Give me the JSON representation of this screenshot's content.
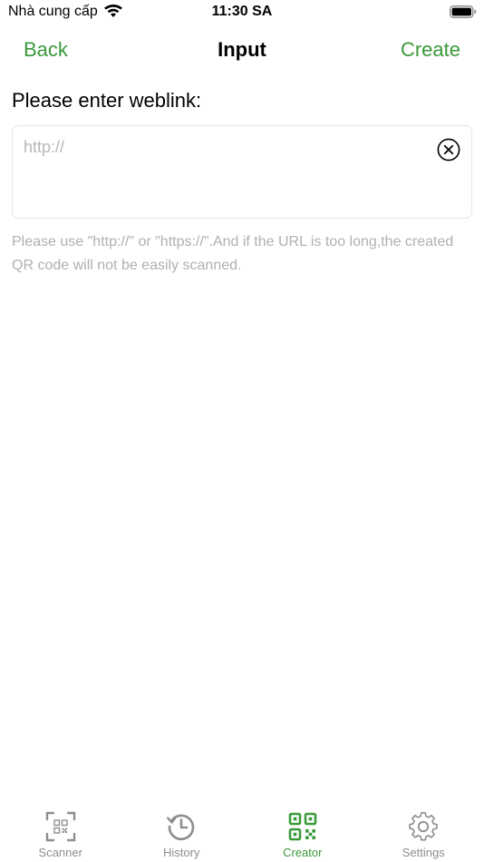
{
  "status_bar": {
    "carrier": "Nhà cung cấp",
    "time": "11:30 SA",
    "icons": [
      "wifi-icon",
      "battery-icon"
    ]
  },
  "nav": {
    "back_label": "Back",
    "title": "Input",
    "create_label": "Create"
  },
  "form": {
    "prompt": "Please enter weblink:",
    "input_value": "",
    "input_placeholder": "http://",
    "hint": "Please use \"http://\" or \"https://\".And if the URL is too long,the created QR code will not be easily scanned."
  },
  "tabs": [
    {
      "label": "Scanner",
      "icon": "qr-scan-icon",
      "active": false
    },
    {
      "label": "History",
      "icon": "history-clock-icon",
      "active": false
    },
    {
      "label": "Creator",
      "icon": "qr-code-icon",
      "active": true
    },
    {
      "label": "Settings",
      "icon": "gear-icon",
      "active": false
    }
  ],
  "colors": {
    "accent": "#3a9a3a",
    "inactive": "#8e8e8e",
    "placeholder": "#b8b8b8",
    "hint": "#b0b0b0"
  }
}
